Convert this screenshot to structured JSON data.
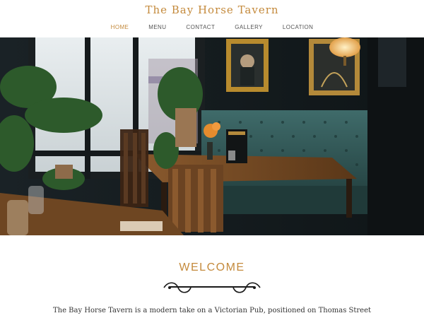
{
  "site": {
    "title": "The Bay Horse Tavern"
  },
  "nav": {
    "items": [
      {
        "label": "HOME"
      },
      {
        "label": "MENU"
      },
      {
        "label": "CONTACT"
      },
      {
        "label": "GALLERY"
      },
      {
        "label": "LOCATION"
      }
    ],
    "active_index": 0
  },
  "hero": {
    "alt": "Bar interior with tufted green booth seating, wooden tables and chairs, large windows and plants"
  },
  "welcome": {
    "heading": "WELCOME",
    "text": "The Bay Horse Tavern is a modern take on a Victorian Pub, positioned on Thomas Street"
  },
  "colors": {
    "accent": "#c48a3c",
    "nav_text": "#555555",
    "body_text": "#333333",
    "bg": "#ffffff"
  }
}
